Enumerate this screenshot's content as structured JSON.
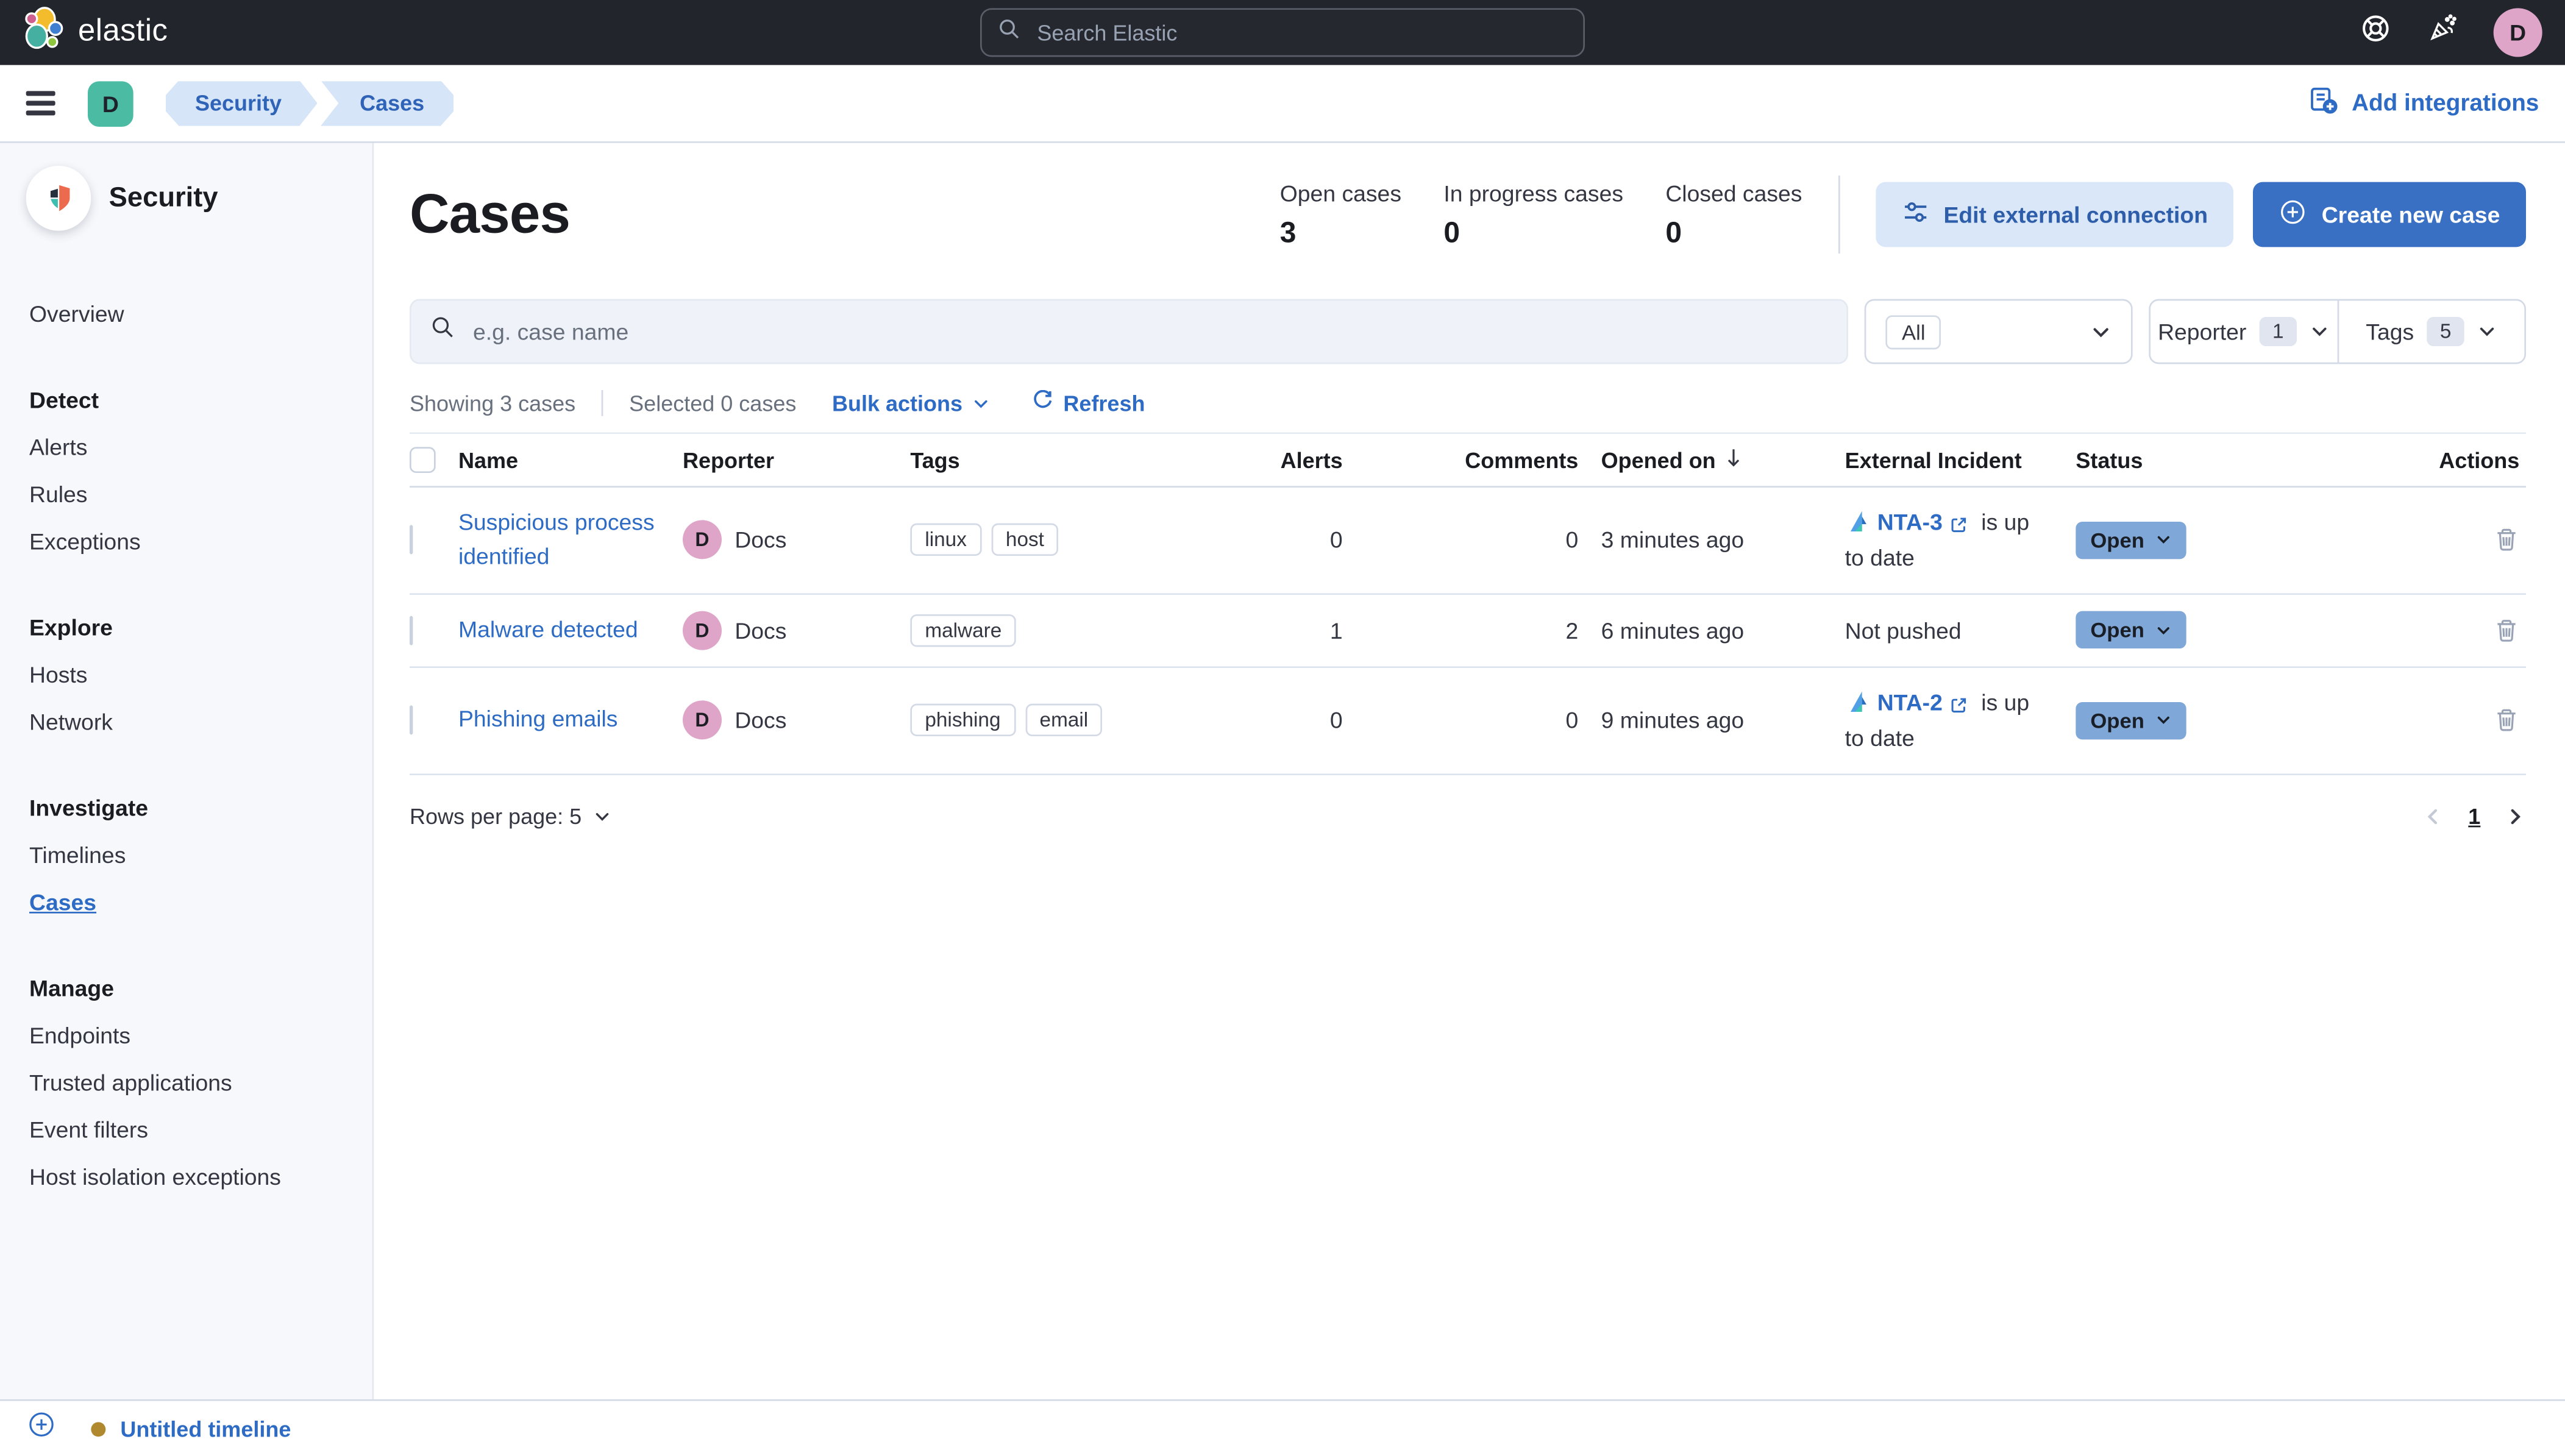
{
  "topbar": {
    "brand": "elastic",
    "search_placeholder": "Search Elastic",
    "avatar_initial": "D"
  },
  "breadcrumbs": {
    "space_initial": "D",
    "items": [
      "Security",
      "Cases"
    ],
    "add_integrations": "Add integrations"
  },
  "sidebar": {
    "title": "Security",
    "groups": [
      {
        "items": [
          {
            "label": "Overview"
          }
        ]
      },
      {
        "heading": "Detect",
        "items": [
          {
            "label": "Alerts"
          },
          {
            "label": "Rules"
          },
          {
            "label": "Exceptions"
          }
        ]
      },
      {
        "heading": "Explore",
        "items": [
          {
            "label": "Hosts"
          },
          {
            "label": "Network"
          }
        ]
      },
      {
        "heading": "Investigate",
        "items": [
          {
            "label": "Timelines"
          },
          {
            "label": "Cases",
            "active": true
          }
        ]
      },
      {
        "heading": "Manage",
        "items": [
          {
            "label": "Endpoints"
          },
          {
            "label": "Trusted applications"
          },
          {
            "label": "Event filters"
          },
          {
            "label": "Host isolation exceptions"
          }
        ]
      }
    ]
  },
  "timeline_bar": {
    "label": "Untitled timeline"
  },
  "page": {
    "title": "Cases",
    "stats": [
      {
        "label": "Open cases",
        "value": "3"
      },
      {
        "label": "In progress cases",
        "value": "0"
      },
      {
        "label": "Closed cases",
        "value": "0"
      }
    ],
    "actions": {
      "edit_external": "Edit external connection",
      "create_case": "Create new case"
    },
    "filters": {
      "search_placeholder": "e.g. case name",
      "status_filter": "All",
      "reporter": {
        "label": "Reporter",
        "count": "1"
      },
      "tags": {
        "label": "Tags",
        "count": "5"
      }
    },
    "toolbar": {
      "showing": "Showing 3 cases",
      "selected": "Selected 0 cases",
      "bulk_actions": "Bulk actions",
      "refresh": "Refresh"
    },
    "table": {
      "headers": [
        "Name",
        "Reporter",
        "Tags",
        "Alerts",
        "Comments",
        "Opened on",
        "External Incident",
        "Status",
        "Actions"
      ],
      "rows": [
        {
          "name": "Suspicious process identified",
          "reporter": "Docs",
          "reporter_initial": "D",
          "tags": [
            "linux",
            "host"
          ],
          "alerts": "0",
          "comments": "0",
          "opened_on": "3 minutes ago",
          "external_ref": "NTA-3",
          "external_suffix": "is up to date",
          "status": "Open"
        },
        {
          "name": "Malware detected",
          "reporter": "Docs",
          "reporter_initial": "D",
          "tags": [
            "malware"
          ],
          "alerts": "1",
          "comments": "2",
          "opened_on": "6 minutes ago",
          "external_text": "Not pushed",
          "status": "Open"
        },
        {
          "name": "Phishing emails",
          "reporter": "Docs",
          "reporter_initial": "D",
          "tags": [
            "phishing",
            "email"
          ],
          "alerts": "0",
          "comments": "0",
          "opened_on": "9 minutes ago",
          "external_ref": "NTA-2",
          "external_suffix": "is up to date",
          "status": "Open"
        }
      ],
      "pagination": {
        "rows_per_page": "Rows per page: 5",
        "current_page": "1"
      }
    }
  },
  "colors": {
    "header_dark": "#23252d",
    "accent_link": "#2d6bc4",
    "primary_button": "#3a70c4",
    "primary_button_light_bg": "#d9e7f9",
    "status_badge_bg": "#7fa8d8",
    "avatar_pink": "#dfa5c8",
    "space_badge_teal": "#4cbba4",
    "breadcrumb_chip_bg": "#d7e5f8",
    "timeline_dot_gold": "#b0892f",
    "sidebar_bg": "#f6f8fb"
  },
  "icons": {
    "topbar": [
      "elastic-logo",
      "search-icon",
      "help-lifebuoy-icon",
      "whats-new-party-icon"
    ],
    "page": [
      "sliders-icon",
      "plus-circle-icon",
      "refresh-icon",
      "sort-desc-icon",
      "external-link-icon",
      "incident-kite-icon",
      "trash-icon",
      "chevron-down-icon"
    ]
  }
}
